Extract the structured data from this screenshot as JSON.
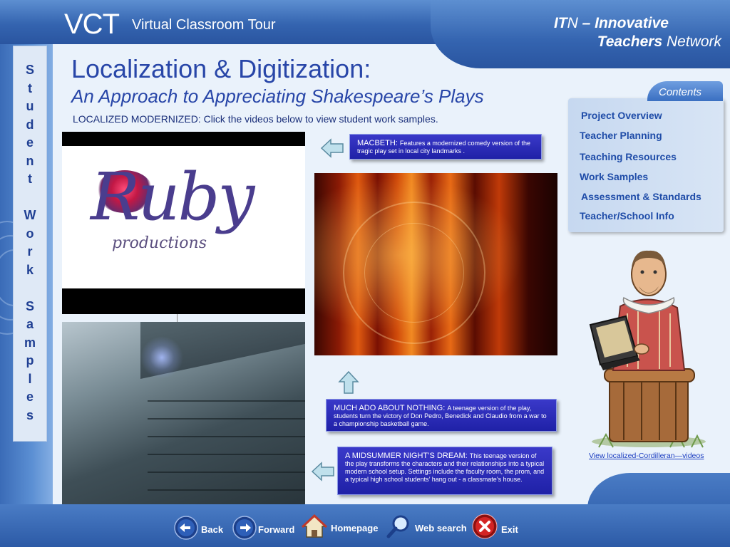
{
  "header": {
    "brand": "VCT",
    "brand_sub": "Virtual Classroom Tour",
    "network_line1_bold": "IT",
    "network_line1_italic": "N",
    "network_line1_rest": " – Innovative",
    "network_line2_bold": "Teachers",
    "network_line2_rest": " Network"
  },
  "side_title": [
    "S",
    "t",
    "u",
    "d",
    "e",
    "n",
    "t",
    "",
    "W",
    "o",
    "r",
    "k",
    "",
    "S",
    "a",
    "m",
    "p",
    "l",
    "e",
    "s"
  ],
  "title": {
    "main": "Localization & Digitization:",
    "sub": "An Approach to Appreciating Shakespeare’s Plays",
    "instruction": "LOCALIZED MODERNIZED: Click the videos below to view student work samples."
  },
  "videos": {
    "ruby_word": "Ruby",
    "ruby_sub": "productions"
  },
  "captions": {
    "macbeth_title": "MACBETH: ",
    "macbeth_text": "Features a modernized comedy version of the tragic play set in local city landmarks .",
    "much_title": "MUCH ADO ABOUT NOTHING: ",
    "much_text": "A teenage version of the play, students turn the victory of Don Pedro, Benedick and Claudio from a war to a championship basketball game.",
    "mid_title": "A MIDSUMMER NIGHT’S DREAM: ",
    "mid_text": "This teenage version of the play transforms the characters and their relationships into a typical modern school setup. Settings include the faculty room, the prom, and a typical high school students’ hang out - a classmate’s house."
  },
  "contents": {
    "label": "Contents",
    "items": [
      "Project Overview",
      "Teacher Planning",
      "Teaching Resources",
      "Work Samples",
      "Assessment & Standards",
      "Teacher/School Info"
    ]
  },
  "link": {
    "part1": "View localized-Cordilleran",
    "dash": "—",
    "part2": "videos"
  },
  "bottom_nav": {
    "back": "Back",
    "forward": "Forward",
    "homepage": "Homepage",
    "web_search": "Web search",
    "exit": "Exit"
  },
  "colors": {
    "title_blue": "#2846a8",
    "caption_blue": "#2a2bb8",
    "nav_link_blue": "#1f4ca8",
    "frame_blue": "#3464b0"
  }
}
